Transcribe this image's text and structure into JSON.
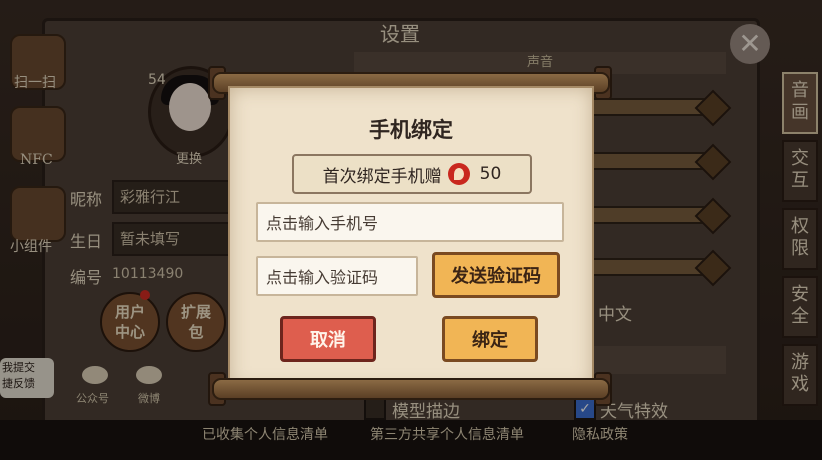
{
  "background": {
    "panel_title": "设置",
    "left_tools": [
      {
        "label": "扫一扫"
      },
      {
        "label": "NFC"
      },
      {
        "label": "小组件"
      }
    ],
    "level": "54",
    "change_avatar": "更换",
    "nickname_label": "昵称",
    "nickname_value": "彩雅行江",
    "birthday_label": "生日",
    "birthday_value": "暂未填写",
    "id_label": "编号",
    "id_value": "10113490",
    "user_center": "用户中心",
    "expand_pack": "扩展包",
    "official_account": "公众号",
    "weibo": "微博",
    "sound_header": "声音",
    "language_value": "中文",
    "model_outline": "模型描边",
    "weather_effect": "天气特效",
    "feedback": "我提交\n捷反馈",
    "tabs": [
      "音画",
      "交互",
      "权限",
      "安全",
      "游戏"
    ],
    "footer_links": [
      "已收集个人信息清单",
      "第三方共享个人信息清单",
      "隐私政策"
    ]
  },
  "dialog": {
    "title": "手机绑定",
    "bonus_text": "首次绑定手机赠",
    "bonus_amount": "50",
    "phone_placeholder": "点击输入手机号",
    "code_placeholder": "点击输入验证码",
    "send_code": "发送验证码",
    "cancel": "取消",
    "confirm": "绑定"
  },
  "colors": {
    "paper": "#efe2cb",
    "send_button": "#f1b555",
    "cancel_button": "#de5e4e",
    "coin": "#c9281e"
  }
}
